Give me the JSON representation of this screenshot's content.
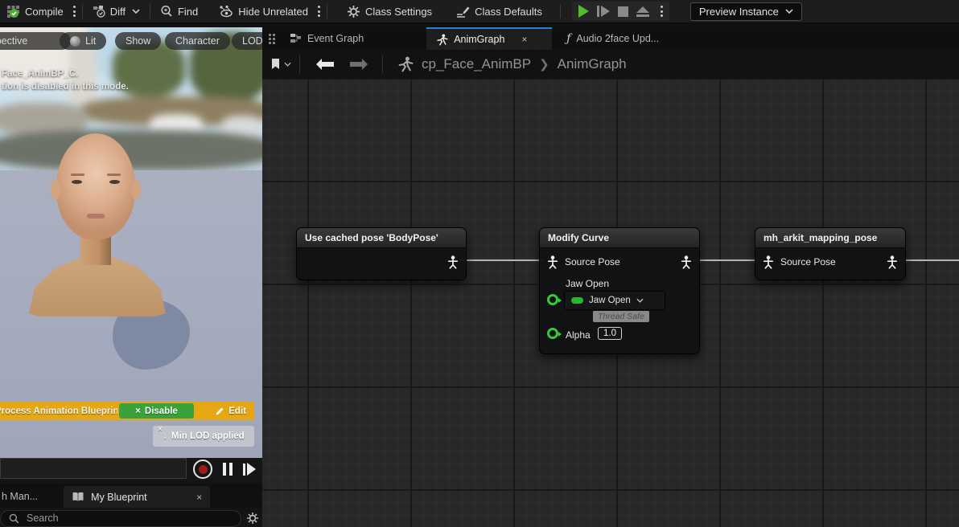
{
  "toolbar": {
    "compile": "Compile",
    "diff": "Diff",
    "find": "Find",
    "hide_unrelated": "Hide Unrelated",
    "class_settings": "Class Settings",
    "class_defaults": "Class Defaults",
    "preview_instance": "Preview Instance"
  },
  "left_panel": {
    "pills": {
      "perspective": "Perspective",
      "lit": "Lit",
      "show": "Show",
      "character": "Character",
      "lod": "LOD Auto"
    },
    "overlay": {
      "line1": "Face_AnimBP_C.",
      "line2": "tion is disabled in this mode."
    },
    "post_process_bar": {
      "label": "Process Animation Blueprint",
      "disable": "Disable",
      "disable_x": "×",
      "edit": "Edit"
    },
    "lod_badge": {
      "close": "×",
      "arrow": "↓",
      "label": "Min LOD applied"
    },
    "bottom_tabs": {
      "partial": "h Man...",
      "active": "My Blueprint",
      "close": "×"
    },
    "search_placeholder": "Search"
  },
  "graph": {
    "tabs": [
      {
        "label": "Event Graph"
      },
      {
        "label": "AnimGraph",
        "close": "×"
      },
      {
        "label": "Audio 2face Upd...",
        "icon": "ƒ"
      }
    ],
    "breadcrumb": {
      "root": "cp_Face_AnimBP",
      "sep": "❯",
      "current": "AnimGraph"
    },
    "nodes": {
      "cached_pose": {
        "title": "Use cached pose 'BodyPose'"
      },
      "modify_curve": {
        "title": "Modify Curve",
        "pose_row": "Source Pose",
        "curve_name": "Jaw Open",
        "curve_value": "Jaw Open",
        "watermark": "Thread Safe",
        "alpha_label": "Alpha",
        "alpha_value": "1.0"
      },
      "mapping_pose": {
        "title": "mh_arkit_mapping_pose",
        "pose_row": "Source Pose"
      }
    }
  },
  "colors": {
    "accent_tab_blue": "#2b80d6",
    "play_green": "#52bb2e",
    "pin_green": "#35c93c",
    "post_process_yellow": "#e5a714",
    "disable_green": "#3ba23b",
    "record_red": "#a11a1a",
    "viewport_backdrop": "#a7acbe",
    "shadow_blue": "#7e89a3",
    "graph_bg": "#282828"
  }
}
